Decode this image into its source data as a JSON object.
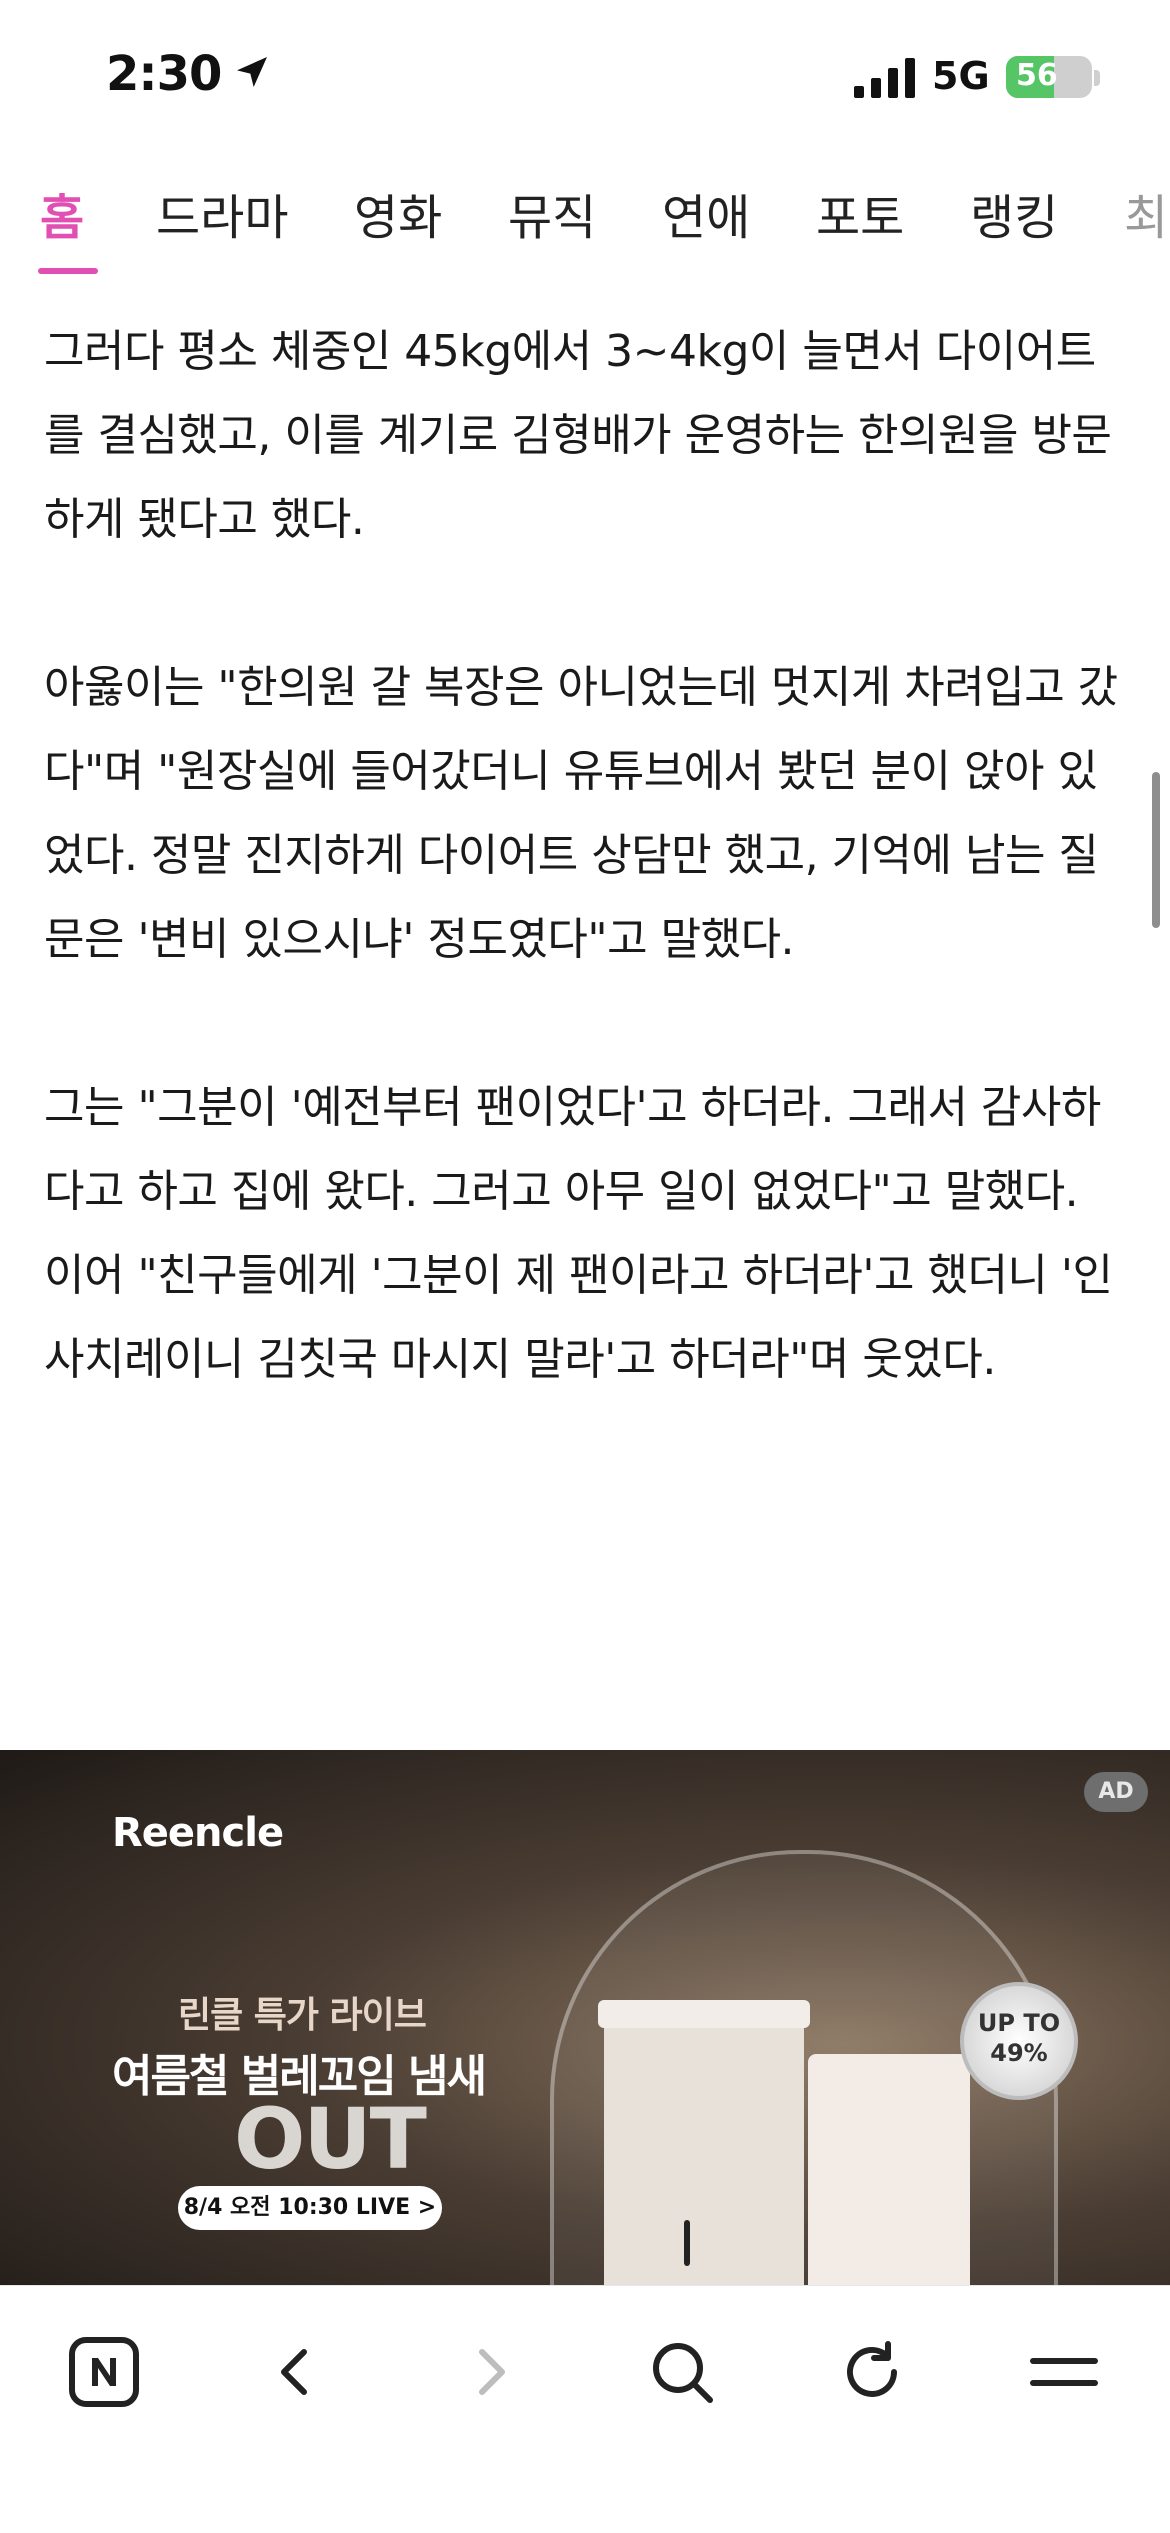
{
  "status_bar": {
    "time": "2:30",
    "network": "5G",
    "battery_level": "56",
    "battery_fraction": 0.56,
    "battery_color": "#56c565"
  },
  "tabs": [
    {
      "label": "홈",
      "active": true
    },
    {
      "label": "드라마"
    },
    {
      "label": "영화"
    },
    {
      "label": "뮤직"
    },
    {
      "label": "연애"
    },
    {
      "label": "포토"
    },
    {
      "label": "랭킹"
    },
    {
      "label": "최"
    }
  ],
  "accent_color": "#e14fb3",
  "article": {
    "paragraphs": [
      "그러다 평소 체중인 45kg에서 3~4kg이 늘면서 다이어트를 결심했고, 이를 계기로 김형배가 운영하는 한의원을 방문하게 됐다고 했다.",
      "아옳이는 \"한의원 갈 복장은 아니었는데 멋지게 차려입고 갔다\"며 \"원장실에 들어갔더니 유튜브에서 봤던 분이 앉아 있었다. 정말 진지하게 다이어트 상담만 했고, 기억에 남는 질문은 '변비 있으시냐' 정도였다\"고 말했다.",
      "그는 \"그분이 '예전부터 팬이었다'고 하더라. 그래서 감사하다고 하고 집에 왔다. 그러고 아무 일이 없었다\"고 말했다. 이어 \"친구들에게 '그분이 제 팬이라고 하더라'고 했더니 '인사치레이니 김칫국 마시지 말라'고 하더라\"며 웃었다."
    ]
  },
  "ad": {
    "brand": "Reencle",
    "badge": "AD",
    "subtitle": "린클 특가 라이브",
    "headline": "여름철 벌레꼬임 냄새",
    "big_word": "OUT",
    "live_button": "8/4 오전 10:30 LIVE >",
    "circle_line1": "UP TO",
    "circle_line2": "49%"
  },
  "toolbar": {
    "icons": [
      "naver-home-icon",
      "back-icon",
      "forward-icon",
      "search-icon",
      "refresh-icon",
      "menu-icon"
    ]
  }
}
